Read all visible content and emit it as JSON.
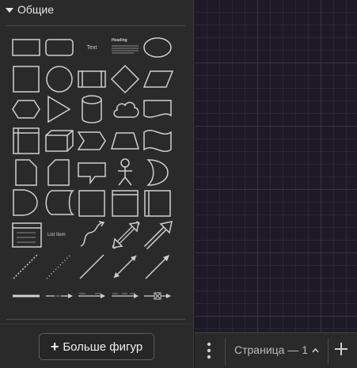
{
  "sidebar": {
    "section_title": "Общие",
    "shapes": {
      "text_label": "Text",
      "heading_label": "Heading",
      "list_item_label": "List Item"
    },
    "more_shapes_label": "Больше фигур",
    "more_shapes_icon": "+"
  },
  "pagebar": {
    "page_label": "Страница — 1",
    "menu_icon": "kebab-menu-icon",
    "add_icon": "plus-icon"
  }
}
